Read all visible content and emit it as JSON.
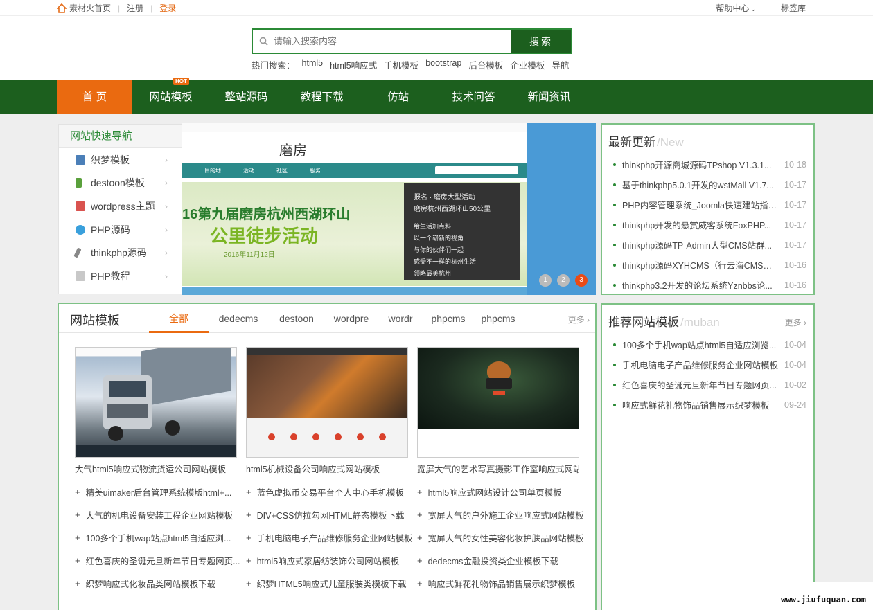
{
  "topbar": {
    "home": "素材火首页",
    "register": "注册",
    "login": "登录",
    "help": "帮助中心",
    "tags": "标签库"
  },
  "search": {
    "placeholder": "请输入搜索内容",
    "button": "搜索",
    "hot_label": "热门搜索：",
    "hot_items": [
      "html5",
      "html5响应式",
      "手机模板",
      "bootstrap",
      "后台模板",
      "企业模板",
      "导航"
    ]
  },
  "nav": {
    "items": [
      "首 页",
      "网站模板",
      "整站源码",
      "教程下载",
      "仿站",
      "技术问答",
      "新闻资讯"
    ],
    "hot_badge": "HOT"
  },
  "quicknav": {
    "title": "网站快速导航",
    "items": [
      "织梦模板",
      "destoon模板",
      "wordpress主题",
      "PHP源码",
      "thinkphp源码",
      "PHP教程"
    ]
  },
  "banner": {
    "logo": "磨房",
    "nav": [
      "目的地",
      "活动",
      "社区",
      "服务"
    ],
    "headline1": "16第九届磨房杭州西湖环山",
    "headline2": "公里徒步活动",
    "date": "2016年11月12日",
    "popup_title": "报名 · 磨房大型活动",
    "popup_sub": "磨房杭州西湖环山50公里",
    "popup_lines": [
      "给生活加点料",
      "以一个崭新的视角",
      "与你的伙伴们一起",
      "感受不一样的杭州生活",
      "领略最美杭州"
    ],
    "dots": [
      "1",
      "2",
      "3"
    ]
  },
  "latest": {
    "title": "最新更新",
    "title_en": "/New",
    "items": [
      {
        "t": "thinkphp开源商城源码TPshop V1.3.1...",
        "d": "10-18"
      },
      {
        "t": "基于thinkphp5.0.1开发的wstMall V1.7...",
        "d": "10-17"
      },
      {
        "t": "PHP内容管理系统_Joomla快速建站指南...",
        "d": "10-17"
      },
      {
        "t": "thinkphp开发的悬赏威客系统FoxPHP...",
        "d": "10-17"
      },
      {
        "t": "thinkphp源码TP-Admin大型CMS站群...",
        "d": "10-17"
      },
      {
        "t": "thinkphp源码XYHCMS（行云海CMS）...",
        "d": "10-16"
      },
      {
        "t": "thinkphp3.2开发的论坛系统Yznbbs论...",
        "d": "10-16"
      }
    ]
  },
  "recommend": {
    "title": "推荐网站模板",
    "title_en": "/muban",
    "more": "更多",
    "items": [
      {
        "t": "100多个手机wap站点html5自适应浏览...",
        "d": "10-04"
      },
      {
        "t": "手机电脑电子产品维修服务企业网站模板",
        "d": "10-04"
      },
      {
        "t": "红色喜庆的圣诞元旦新年节日专题网页...",
        "d": "10-02"
      },
      {
        "t": "响应式鲜花礼物饰品销售展示织梦模板",
        "d": "09-24"
      }
    ]
  },
  "templates": {
    "title": "网站模板",
    "tabs": [
      "全部",
      "dedecms",
      "destoon",
      "wordpre",
      "wordr",
      "phpcms",
      "phpcms"
    ],
    "more": "更多",
    "cards": [
      "大气html5响应式物流货运公司网站模板",
      "html5机械设备公司响应式网站模板",
      "宽屏大气的艺术写真摄影工作室响应式网站"
    ],
    "col1": [
      "精美uimaker后台管理系统模版html+...",
      "大气的机电设备安装工程企业网站模板",
      "100多个手机wap站点html5自适应浏...",
      "红色喜庆的圣诞元旦新年节日专题网页...",
      "织梦响应式化妆品类网站模板下载"
    ],
    "col2": [
      "蓝色虚拟币交易平台个人中心手机模板",
      "DIV+CSS仿拉勾网HTML静态模板下载",
      "手机电脑电子产品维修服务企业网站模板",
      "html5响应式家居纺装饰公司网站模板",
      "织梦HTML5响应式儿童服装类模板下载"
    ],
    "col3": [
      "html5响应式网站设计公司单页模板",
      "宽屏大气的户外施工企业响应式网站模板",
      "宽屏大气的女性美容化妆护肤品网站模板",
      "dedecms金融投资类企业模板下载",
      "响应式鲜花礼物饰品销售展示织梦模板"
    ]
  },
  "watermark": "www.jiufuquan.com",
  "colors": {
    "nav_green": "#1c5f1e",
    "accent_orange": "#ea6a10",
    "border_green": "#7dc185"
  }
}
